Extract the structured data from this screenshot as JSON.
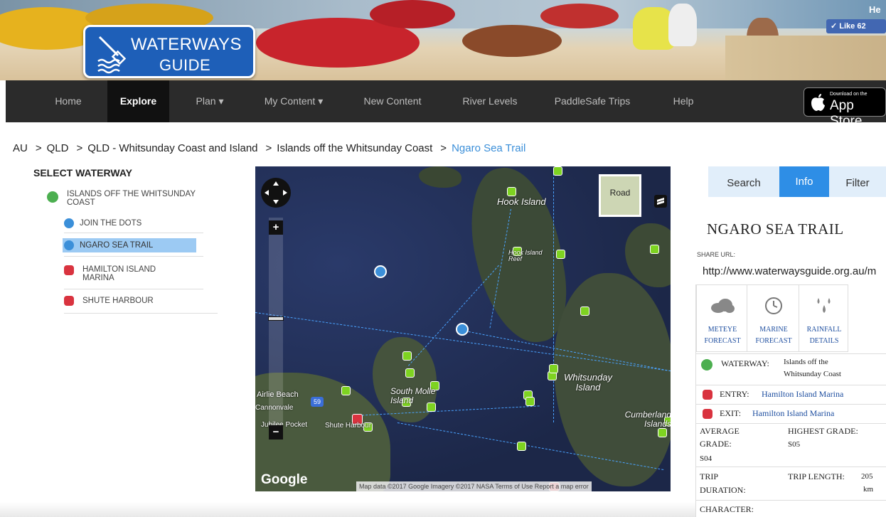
{
  "header": {
    "logo_line1": "WATERWAYS",
    "logo_line2": "GUIDE",
    "like_label": "✓ Like 62",
    "corner_text": "He"
  },
  "nav": {
    "items": [
      {
        "label": "Home"
      },
      {
        "label": "Explore"
      },
      {
        "label": "Plan ▾"
      },
      {
        "label": "My Content ▾"
      },
      {
        "label": "New Content"
      },
      {
        "label": "River Levels"
      },
      {
        "label": "PaddleSafe Trips"
      },
      {
        "label": "Help"
      }
    ],
    "active": "Explore",
    "appstore_small": "Download on the",
    "appstore_big": "App Store"
  },
  "breadcrumb": [
    "AU",
    "QLD",
    "QLD - Whitsunday Coast and Island",
    "Islands off the Whitsunday Coast",
    "Ngaro Sea Trail"
  ],
  "breadcrumb_sep": ">",
  "select_waterway": {
    "title": "SELECT WATERWAY",
    "items": [
      {
        "label": "ISLANDS OFF THE WHITSUNDAY COAST",
        "icon": "waterway-icon"
      },
      {
        "label": "JOIN THE DOTS",
        "icon": "sea-trail-icon"
      },
      {
        "label": "NGARO SEA TRAIL",
        "icon": "sea-trail-icon",
        "selected": true
      },
      {
        "label": "HAMILTON ISLAND MARINA",
        "icon": "car-icon"
      },
      {
        "label": "SHUTE HARBOUR",
        "icon": "car-icon"
      }
    ]
  },
  "map": {
    "labels": {
      "hook_island": "Hook Island",
      "hook_reef": "Hook Island Reef",
      "whitsunday": "Whitsunday Island",
      "south_molle": "South Molle Island",
      "cumberland": "Cumberland Islands",
      "airlie": "Airlie Beach",
      "cannonvale": "Cannonvale",
      "jubilee": "Jubilee Pocket",
      "shute": "Shute Harbour",
      "road_num": "59"
    },
    "road_button": "Road",
    "zoom_in": "+",
    "zoom_out": "−",
    "google": "Google",
    "attribution": "Map data ©2017 Google Imagery ©2017 NASA   Terms of Use   Report a map error"
  },
  "panel": {
    "tabs": [
      "Search",
      "Info",
      "Filter"
    ],
    "active_tab": "Info",
    "waterway_name": "NGARO SEA TRAIL",
    "share_label": "SHARE URL:",
    "share_url": "http://www.waterwaysguide.org.au/m",
    "weather_links": [
      {
        "label1": "METEYE",
        "label2": "FORECAST",
        "icon": "cloud-icon"
      },
      {
        "label1": "MARINE",
        "label2": "FORECAST",
        "icon": "clock-icon"
      },
      {
        "label1": "RAINFALL",
        "label2": "DETAILS",
        "icon": "raindrops-icon"
      }
    ],
    "waterway_label": "WATERWAY:",
    "waterway_value1": "Islands off the",
    "waterway_value2": "Whitsunday Coast",
    "entry_label": "ENTRY:",
    "entry_value": "Hamilton Island Marina",
    "exit_label": "EXIT:",
    "exit_value": "Hamilton Island Marina",
    "avg_grade_label1": "AVERAGE",
    "avg_grade_label2": "GRADE:",
    "avg_grade_value": "S04",
    "highest_grade_label": "HIGHEST GRADE:",
    "highest_grade_value": "S05",
    "trip_duration_label1": "TRIP",
    "trip_duration_label2": "DURATION:",
    "trip_length_label": "TRIP LENGTH:",
    "trip_length_value1": "205",
    "trip_length_value2": "km",
    "character_label": "CHARACTER:"
  }
}
